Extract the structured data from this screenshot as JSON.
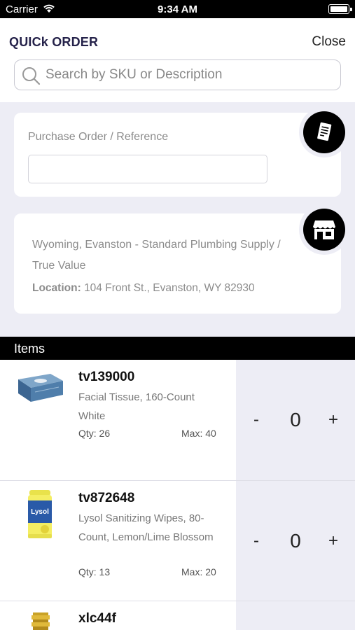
{
  "status_bar": {
    "carrier": "Carrier",
    "time": "9:34 AM"
  },
  "header": {
    "title": "QUICk ORDER",
    "close_label": "Close",
    "search_placeholder": "Search by SKU or Description"
  },
  "purchase_order": {
    "label": "Purchase Order / Reference",
    "value": ""
  },
  "store": {
    "name": "Wyoming, Evanston - Standard Plumbing Supply / True Value",
    "location_label": "Location:",
    "location_value": "104 Front St., Evanston, WY 82930"
  },
  "items_section": {
    "title": "Items"
  },
  "items": [
    {
      "sku": "tv139000",
      "description": "Facial Tissue, 160-Count White",
      "qty": "Qty: 26",
      "max": "Max: 40",
      "order_qty": "0",
      "minus": "-",
      "plus": "+",
      "image_icon": "tissue-box-image"
    },
    {
      "sku": "tv872648",
      "description": "Lysol Sanitizing Wipes, 80-Count, Lemon/Lime Blossom",
      "qty": "Qty: 13",
      "max": "Max: 20",
      "order_qty": "0",
      "minus": "-",
      "plus": "+",
      "image_icon": "wipes-canister-image"
    },
    {
      "sku": "xlc44f",
      "image_icon": "fitting-image"
    }
  ],
  "icons": {
    "po_badge": "receipt-icon",
    "store_badge": "store-icon"
  }
}
